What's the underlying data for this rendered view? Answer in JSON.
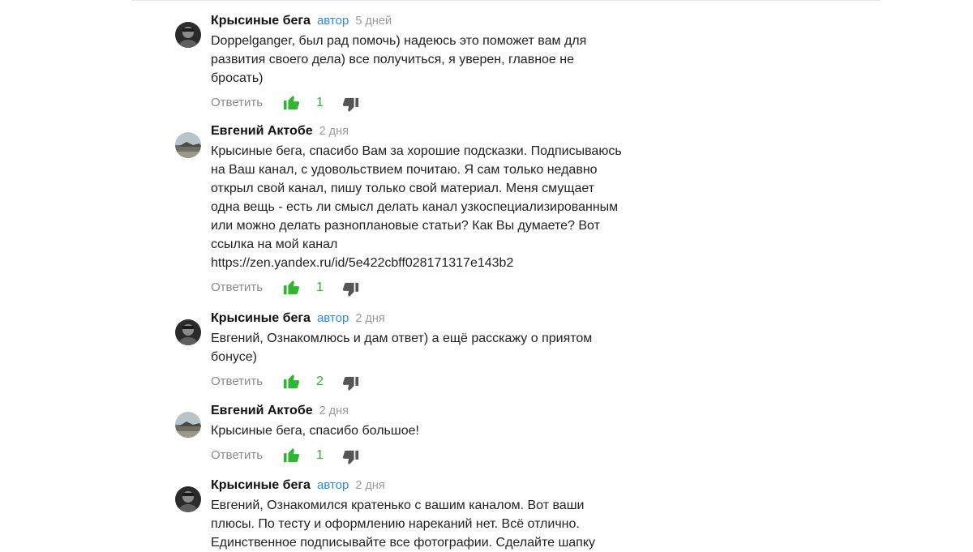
{
  "colors": {
    "author_badge": "#2a8ae0",
    "like_active": "#2fb52f",
    "dislike": "#555555",
    "muted": "#8a8a8a"
  },
  "comments": [
    {
      "author": "Крысиные бега",
      "badge": "автор",
      "time": "5 дней",
      "text": "Doppelganger, был рад помочь) надеюсь это поможет вам для\nразвития своего дела) все получиться, я уверен, главное не\nбросать)",
      "reply_label": "Ответить",
      "likes": "1",
      "avatar": "dark-portrait"
    },
    {
      "author": "Евгений Актобе",
      "time": "2 дня",
      "text": "Крысиные бега, спасибо Вам за хорошие подсказки. Подписываюсь\nна Ваш канал, с удовольствием почитаю. Я сам только недавно\nоткрыл свой канал, пишу только свой материал. Меня смущает\nодна вещь - есть ли смысл делать канал узкоспециализированным\nили можно делать разноплановые статьи? Как Вы думаете? Вот\nссылка на мой канал\nhttps://zen.yandex.ru/id/5e422cbff028171317e143b2",
      "reply_label": "Ответить",
      "likes": "1",
      "avatar": "landscape"
    },
    {
      "author": "Крысиные бега",
      "badge": "автор",
      "time": "2 дня",
      "text": "Евгений, Ознакомлюсь и дам ответ) а ещё расскажу о приятом\nбонусе)",
      "reply_label": "Ответить",
      "likes": "2",
      "avatar": "dark-portrait"
    },
    {
      "author": "Евгений Актобе",
      "time": "2 дня",
      "text": "Крысиные бега, спасибо большое!",
      "reply_label": "Ответить",
      "likes": "1",
      "avatar": "landscape"
    },
    {
      "author": "Крысиные бега",
      "badge": "автор",
      "time": "2 дня",
      "text": "Евгений, Ознакомился кратенько с вашим каналом. Вот ваши\nплюсы. По тесту и оформлению нареканий нет. Всё отлично.\nЕдинственное подписывайте все фотографии. Сделайте шапку",
      "avatar": "dark-portrait"
    }
  ]
}
